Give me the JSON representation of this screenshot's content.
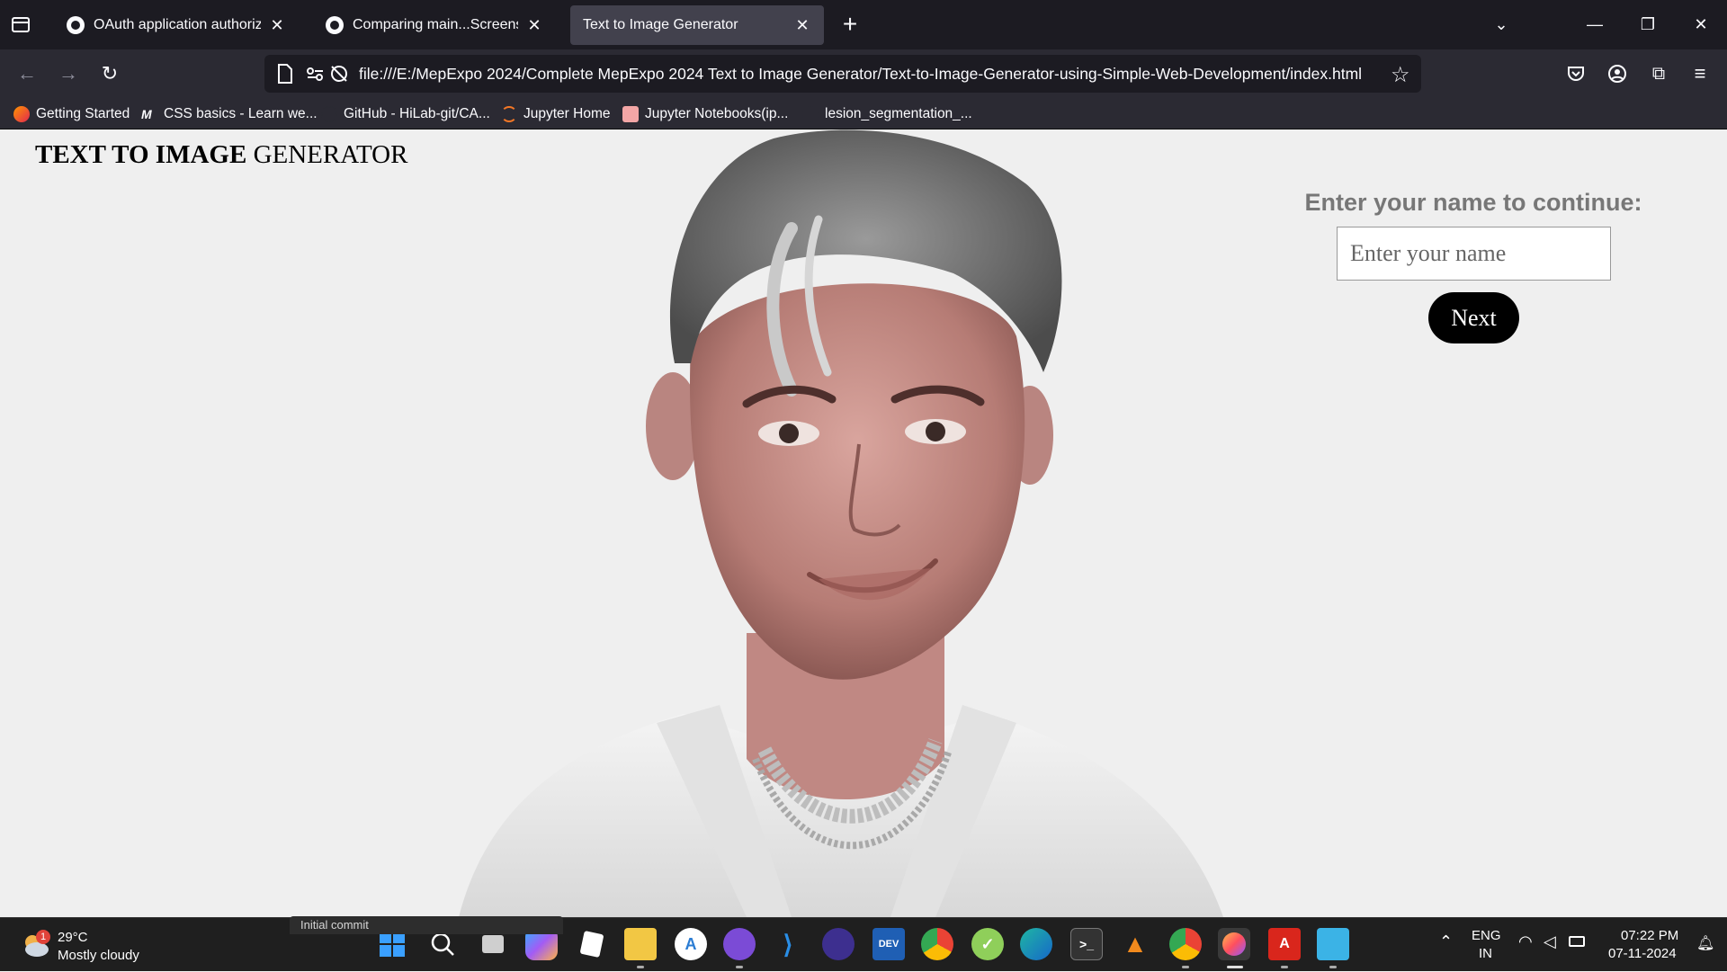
{
  "browser": {
    "tabs": [
      {
        "title": "OAuth application authorized",
        "icon": "github-icon",
        "active": false
      },
      {
        "title": "Comparing main...Screenshot-o",
        "icon": "github-icon",
        "active": false
      },
      {
        "title": "Text to Image Generator",
        "icon": "",
        "active": true
      }
    ],
    "url": "file:///E:/MepExpo 2024/Complete MepExpo 2024 Text to Image Generator/Text-to-Image-Generator-using-Simple-Web-Development/index.html",
    "bookmarks": [
      {
        "label": "Getting Started",
        "icon": "firefox-icon"
      },
      {
        "label": "CSS basics - Learn we...",
        "icon": "mdn-icon"
      },
      {
        "label": "GitHub - HiLab-git/CA...",
        "icon": "github-icon"
      },
      {
        "label": "Jupyter Home",
        "icon": "jupyter-icon"
      },
      {
        "label": "Jupyter Notebooks(ip...",
        "icon": "notebook-icon"
      },
      {
        "label": "lesion_segmentation_...",
        "icon": "page-icon"
      }
    ]
  },
  "page": {
    "heading_bold": "TEXT TO IMAGE",
    "heading_rest": " GENERATOR",
    "form_title": "Enter your name to continue:",
    "name_placeholder": "Enter your name",
    "next_label": "Next"
  },
  "taskbar": {
    "weather_temp": "29°C",
    "weather_desc": "Mostly cloudy",
    "weather_badge": "1",
    "commit_tooltip": "Initial commit",
    "lang_top": "ENG",
    "lang_bottom": "IN",
    "time": "07:22 PM",
    "date": "07-11-2024",
    "apps": [
      "windows-start-icon",
      "search-icon",
      "task-view-icon",
      "copilot-icon",
      "notion-icon",
      "file-explorer-icon",
      "app-store-icon",
      "github-desktop-icon",
      "vscode-icon",
      "eclipse-icon",
      "dev-icon",
      "chrome-icon",
      "tick-icon",
      "edge-icon",
      "terminal-icon",
      "vlc-icon",
      "chrome-alt-icon",
      "firefox-icon",
      "acrobat-icon",
      "notepad-icon"
    ]
  },
  "colors": {
    "tabstrip_bg": "#1c1b22",
    "navbar_bg": "#2b2a33",
    "page_bg": "#efefef",
    "form_title": "#777777",
    "button_bg": "#000000"
  }
}
